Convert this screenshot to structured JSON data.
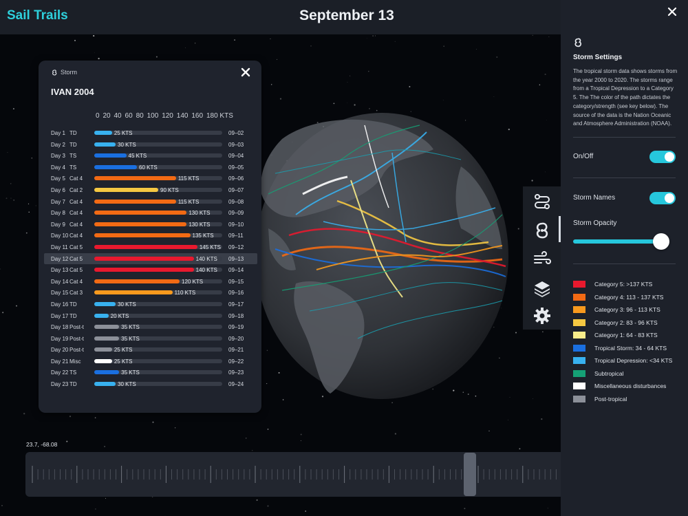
{
  "app": {
    "title": "Sail Trails",
    "date": "September 13"
  },
  "storm_panel": {
    "header_label": "Storm",
    "storm_name": "IVAN 2004",
    "axis_ticks": [
      "0",
      "20",
      "40",
      "60",
      "80",
      "100",
      "120",
      "140",
      "160",
      "180 KTS"
    ],
    "max_kts": 180,
    "days": [
      {
        "day": "Day 1",
        "cat": "TD",
        "kts": 25,
        "kts_label": "25 KTS",
        "date": "09–02",
        "color": "#38b1ef"
      },
      {
        "day": "Day 2",
        "cat": "TD",
        "kts": 30,
        "kts_label": "30 KTS",
        "date": "09–03",
        "color": "#38b1ef"
      },
      {
        "day": "Day 3",
        "cat": "TS",
        "kts": 45,
        "kts_label": "45 KTS",
        "date": "09–04",
        "color": "#1a6fe0"
      },
      {
        "day": "Day 4",
        "cat": "TS",
        "kts": 60,
        "kts_label": "60 KTS",
        "date": "09–05",
        "color": "#1a6fe0"
      },
      {
        "day": "Day 5",
        "cat": "Cat 4",
        "kts": 115,
        "kts_label": "115 KTS",
        "date": "09–06",
        "color": "#f26a14"
      },
      {
        "day": "Day 6",
        "cat": "Cat 2",
        "kts": 90,
        "kts_label": "90 KTS",
        "date": "09–07",
        "color": "#f5c842"
      },
      {
        "day": "Day 7",
        "cat": "Cat 4",
        "kts": 115,
        "kts_label": "115 KTS",
        "date": "09–08",
        "color": "#f26a14"
      },
      {
        "day": "Day 8",
        "cat": "Cat 4",
        "kts": 130,
        "kts_label": "130 KTS",
        "date": "09–09",
        "color": "#f26a14"
      },
      {
        "day": "Day 9",
        "cat": "Cat 4",
        "kts": 130,
        "kts_label": "130 KTS",
        "date": "09–10",
        "color": "#f26a14"
      },
      {
        "day": "Day 10",
        "cat": "Cat 4",
        "kts": 135,
        "kts_label": "135 KTS",
        "date": "09–11",
        "color": "#f26a14"
      },
      {
        "day": "Day 11",
        "cat": "Cat 5",
        "kts": 145,
        "kts_label": "145 KTS",
        "date": "09–12",
        "color": "#e8192e"
      },
      {
        "day": "Day 12",
        "cat": "Cat 5",
        "kts": 140,
        "kts_label": "140 KTS",
        "date": "09–13",
        "color": "#e8192e",
        "selected": true
      },
      {
        "day": "Day 13",
        "cat": "Cat 5",
        "kts": 140,
        "kts_label": "140 KTS",
        "date": "09–14",
        "color": "#e8192e"
      },
      {
        "day": "Day 14",
        "cat": "Cat 4",
        "kts": 120,
        "kts_label": "120 KTS",
        "date": "09–15",
        "color": "#f26a14"
      },
      {
        "day": "Day 15",
        "cat": "Cat 3",
        "kts": 110,
        "kts_label": "110 KTS",
        "date": "09–16",
        "color": "#f89a1e"
      },
      {
        "day": "Day 16",
        "cat": "TD",
        "kts": 30,
        "kts_label": "30 KTS",
        "date": "09–17",
        "color": "#38b1ef"
      },
      {
        "day": "Day 17",
        "cat": "TD",
        "kts": 20,
        "kts_label": "20 KTS",
        "date": "09–18",
        "color": "#38b1ef"
      },
      {
        "day": "Day 18",
        "cat": "Post-t",
        "kts": 35,
        "kts_label": "35 KTS",
        "date": "09–19",
        "color": "#8c9099"
      },
      {
        "day": "Day 19",
        "cat": "Post-t",
        "kts": 35,
        "kts_label": "35 KTS",
        "date": "09–20",
        "color": "#8c9099"
      },
      {
        "day": "Day 20",
        "cat": "Post-t",
        "kts": 25,
        "kts_label": "25 KTS",
        "date": "09–21",
        "color": "#8c9099"
      },
      {
        "day": "Day 21",
        "cat": "Misc",
        "kts": 25,
        "kts_label": "25 KTS",
        "date": "09–22",
        "color": "#ffffff"
      },
      {
        "day": "Day 22",
        "cat": "TS",
        "kts": 35,
        "kts_label": "35 KTS",
        "date": "09–23",
        "color": "#1a6fe0"
      },
      {
        "day": "Day 23",
        "cat": "TD",
        "kts": 30,
        "kts_label": "30 KTS",
        "date": "09–24",
        "color": "#38b1ef"
      }
    ]
  },
  "settings": {
    "title": "Storm Settings",
    "description": "The tropical storm data shows storms from the year 2000 to 2020. The storms range from a Tropical Depression to a Category 5. The  The color of the path dictates the category/strength (see key below). The source of the data is the Nation Oceanic and Atmosphere Administration (NOAA).",
    "onoff_label": "On/Off",
    "onoff_value": true,
    "names_label": "Storm Names",
    "names_value": true,
    "opacity_label": "Storm Opacity",
    "opacity_value": 0.85,
    "legend": [
      {
        "label": "Category 5: >137 KTS",
        "color": "#e8192e"
      },
      {
        "label": "Category 4: 113 - 137 KTS",
        "color": "#f26a14"
      },
      {
        "label": "Category 3: 96 - 113 KTS",
        "color": "#f89a1e"
      },
      {
        "label": "Category 2: 83 - 96 KTS",
        "color": "#f5c842"
      },
      {
        "label": "Category 1: 64 - 83 KTS",
        "color": "#f7ec8a"
      },
      {
        "label": "Tropical Storm: 34 - 64 KTS",
        "color": "#1a6fe0"
      },
      {
        "label": "Tropical Depression: <34 KTS",
        "color": "#38b1ef"
      },
      {
        "label": "Subtropical",
        "color": "#15a075"
      },
      {
        "label": "Miscellaneous disturbances",
        "color": "#ffffff"
      },
      {
        "label": "Post-tropical",
        "color": "#8c9099"
      }
    ]
  },
  "timeline": {
    "coordinates": "23.7, -68.08",
    "position": 0.83
  },
  "icons": {
    "storm": "hurricane-icon",
    "close": "close-icon",
    "routes": "route-icon",
    "wind": "wind-icon",
    "layers": "layers-icon",
    "gear": "gear-icon"
  }
}
